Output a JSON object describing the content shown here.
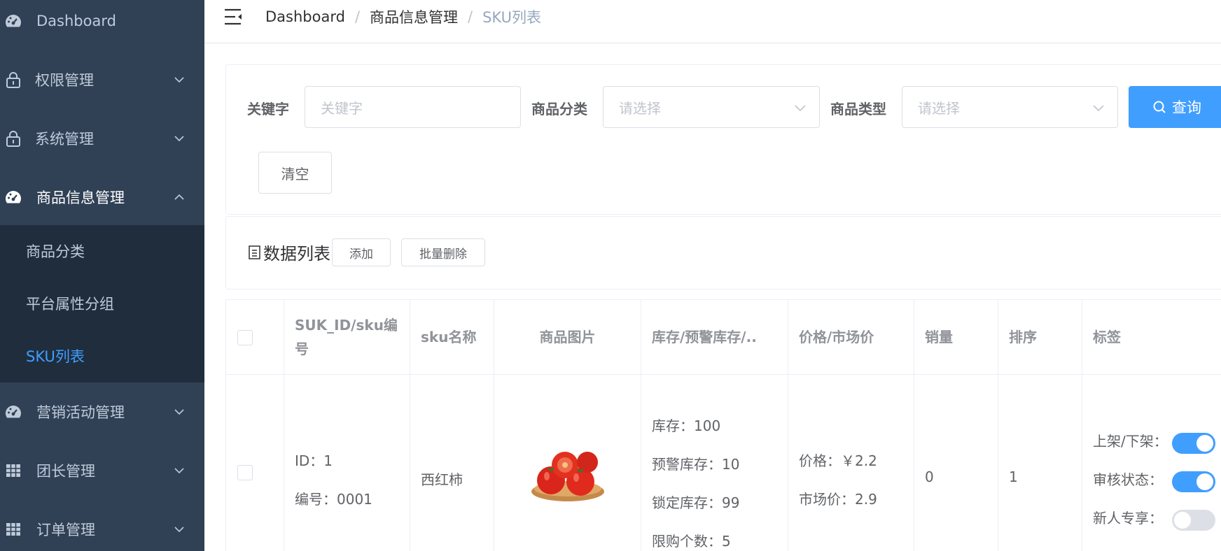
{
  "sidebar": {
    "items": [
      {
        "label": "Dashboard",
        "icon": "dashboard-icon"
      },
      {
        "label": "权限管理",
        "icon": "lock-icon"
      },
      {
        "label": "系统管理",
        "icon": "lock-icon"
      },
      {
        "label": "商品信息管理",
        "icon": "dashboard-icon"
      },
      {
        "label": "营销活动管理",
        "icon": "dashboard-icon"
      },
      {
        "label": "团长管理",
        "icon": "table-icon"
      },
      {
        "label": "订单管理",
        "icon": "table-icon"
      }
    ],
    "submenu": [
      {
        "label": "商品分类"
      },
      {
        "label": "平台属性分组"
      },
      {
        "label": "SKU列表",
        "active": true
      }
    ],
    "active_color": "#409eff",
    "background": "#304156"
  },
  "breadcrumb": [
    "Dashboard",
    "商品信息管理",
    "SKU列表"
  ],
  "search": {
    "keyword_label": "关键字",
    "keyword_placeholder": "关键字",
    "category_label": "商品分类",
    "category_placeholder": "请选择",
    "type_label": "商品类型",
    "type_placeholder": "请选择",
    "query_button": "查询",
    "clear_button": "清空"
  },
  "list": {
    "title": "数据列表",
    "add_button": "添加",
    "batch_delete_button": "批量删除"
  },
  "table": {
    "columns": [
      "SUK_ID/sku编号",
      "sku名称",
      "商品图片",
      "库存/预警库存/..",
      "价格/市场价",
      "销量",
      "排序",
      "标签"
    ],
    "rows": [
      {
        "id_line": "ID：1",
        "code_line": "编号：0001",
        "name": "西红柿",
        "image": "tomato-image",
        "stock": "库存：100",
        "warn_stock": "预警库存：10",
        "lock_stock": "锁定库存：99",
        "limit": "限购个数：5",
        "price": "价格：￥2.2",
        "market_price": "市场价：2.9",
        "sales": "0",
        "sort": "1",
        "tags": [
          {
            "label": "上架/下架：",
            "on": true
          },
          {
            "label": "审核状态：",
            "on": true
          },
          {
            "label": "新人专享：",
            "on": false
          }
        ]
      }
    ]
  }
}
